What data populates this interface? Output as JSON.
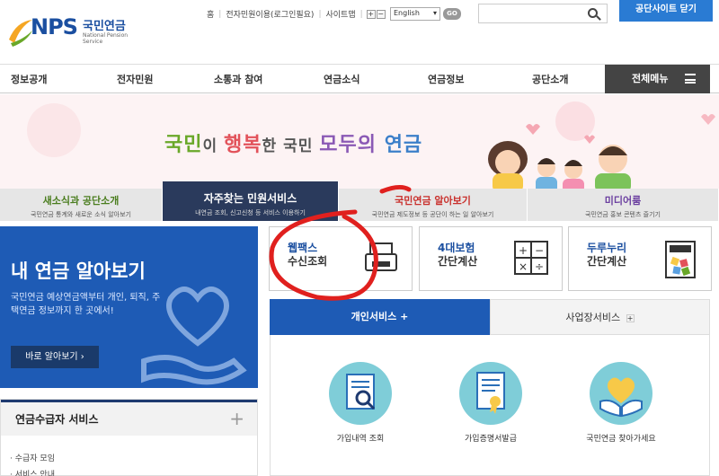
{
  "header": {
    "logo_text": "NPS",
    "logo_kr": "국민연금",
    "logo_en": "National Pension Service",
    "util_links": [
      "홈",
      "전자민원이용(로그인필요)",
      "사이트맵"
    ],
    "font_plus": "+",
    "font_minus": "−",
    "language": "English",
    "go_label": "GO",
    "search_placeholder": "",
    "close_site_label": "공단사이트 닫기"
  },
  "gnb": {
    "items": [
      "정보공개",
      "전자민원",
      "소통과 참여",
      "연금소식",
      "연금정보",
      "공단소개"
    ],
    "full_menu": "전체메뉴"
  },
  "banner": {
    "slogan_parts": [
      "국민",
      "이 ",
      "행복",
      "한 국민 ",
      "모두의 ",
      "연금"
    ]
  },
  "tabs": [
    {
      "title": "새소식과 공단소개",
      "sub": "국민연금 통계와 새로운 소식 알아보기",
      "title_color": "#4a7d1e"
    },
    {
      "title": "자주찾는 민원서비스",
      "sub": "내연금 조회, 신고신청 등 서비스 이용하기",
      "title_color": "#ffffff"
    },
    {
      "title": "국민연금 알아보기",
      "sub": "국민연금 제도정보 등 공단이 하는 일 알아보기",
      "title_color": "#c9302c"
    },
    {
      "title": "미디어룸",
      "sub": "국민연금 홍보 콘텐츠 즐기기",
      "title_color": "#6b3fa0"
    }
  ],
  "mypension": {
    "title": "내 연금 알아보기",
    "desc": "국민연금 예상연금액부터 개인, 퇴직, 주택연금 정보까지 한 곳에서!",
    "button": "바로 알아보기 ›"
  },
  "recipient": {
    "title": "연금수급자 서비스",
    "plus": "+",
    "items": [
      "수급자 모임",
      "서비스 안내"
    ]
  },
  "quick_cards": [
    {
      "line1": "웹팩스",
      "line2": "수신조회"
    },
    {
      "line1": "4대보험",
      "line2": "간단계산"
    },
    {
      "line1": "두루누리",
      "line2": "간단계산"
    }
  ],
  "service_tabs": {
    "personal": "개인서비스",
    "business": "사업장서비스",
    "plus": "+"
  },
  "services": [
    {
      "label": "가입내역 조회"
    },
    {
      "label": "가입증명서발급"
    },
    {
      "label": "국민연금 찾아가세요"
    }
  ]
}
